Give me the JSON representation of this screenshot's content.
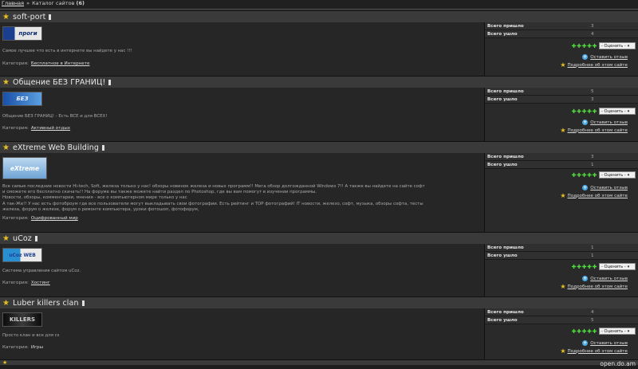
{
  "breadcrumb": {
    "home": "Главная",
    "separator": "»",
    "current": "Каталог сайтов",
    "count": "(6)"
  },
  "labels": {
    "total_in": "Всего пришло",
    "total_out": "Всего ушло",
    "rate": "- Оценить -",
    "leave_review": "Оставить отзыв",
    "more_info": "Подробнее об этом сайте",
    "category": "Категория:"
  },
  "sites": [
    {
      "title": "soft-port",
      "banner_text": "проги",
      "description": "Самое лучшее что есть в интернете вы найдете у нас !!!",
      "category": "Бесплатное в Интернете",
      "in": "3",
      "out": "4"
    },
    {
      "title": "Общение БЕЗ ГРАНИЦ!",
      "banner_text": "БЕЗ",
      "description": "Общение БЕЗ ГРАНИЦ! - Есть ВСЕ и для ВСЕХ!",
      "category": "Активный отдых",
      "in": "5",
      "out": "3"
    },
    {
      "title": "eXtreme Web Building",
      "banner_text": "eXtreme",
      "description": "Все самые последние новости Hi-tech, Soft, железа только у нас! обзоры новинок железа и новых программ!! Мега обзор долгожданной Windows 7!! А также вы найдете на сайте софт\nи сможете его бесплатно скачать!! На форуме вы также можете найти раздел по Photoshop, где вы вам помогут в изучении программы.\nНовости, обзоры, комментарии, мнения - все о компьютерном мире только у нас\nА так-Же!! У нас есть фотоброум где все пользователи могут выкладывать свои фотографии. Есть рейтинг и TOP фотографий! IT новости, железо, софт, музыка, обзоры софта, тесты\nжелеза, форум о железе, форум о ремонте компьютера, уроки фотошоп, фотофорум,",
      "category": "Оцифрованный мир",
      "in": "3",
      "out": "1"
    },
    {
      "title": "uCoz",
      "banner_text": "uCoz WEB",
      "description": "Система управления сайтом uCoz.",
      "category": "Хостинг",
      "in": "1",
      "out": "1"
    },
    {
      "title": "Luber killers clan",
      "banner_text": "KILLERS",
      "description": "Просто клан и все для cs",
      "category": "Игры",
      "in": "4",
      "out": "5"
    }
  ],
  "watermark": "open.do.am",
  "colors": {
    "star": "#e8c021",
    "rating": "#4fe03d",
    "plus": "#4aa8e8"
  }
}
